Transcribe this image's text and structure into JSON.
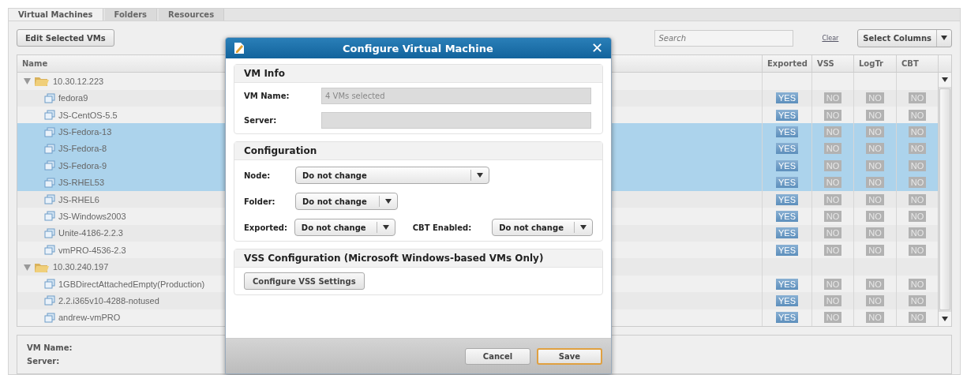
{
  "tabs": [
    {
      "label": "Virtual Machines",
      "selected": true
    },
    {
      "label": "Folders",
      "selected": false
    },
    {
      "label": "Resources",
      "selected": false
    }
  ],
  "toolbar": {
    "edit_button": "Edit Selected VMs",
    "search": {
      "placeholder": "Search"
    },
    "clear_link": "Clear",
    "columns_button": "Select Columns"
  },
  "table": {
    "columns": [
      "Name",
      "Exported",
      "VSS",
      "LogTr",
      "CBT"
    ],
    "groups": [
      {
        "name": "10.30.12.223",
        "expanded": true,
        "children": [
          {
            "name": "fedora9",
            "selected": false,
            "cells": [
              {
                "text": "YES",
                "on": true
              },
              {
                "text": "NO",
                "on": false
              },
              {
                "text": "NO",
                "on": false
              },
              {
                "text": "NO",
                "on": false
              }
            ]
          },
          {
            "name": "JS-CentOS-5.5",
            "selected": false,
            "cells": [
              {
                "text": "YES",
                "on": true
              },
              {
                "text": "NO",
                "on": false
              },
              {
                "text": "NO",
                "on": false
              },
              {
                "text": "NO",
                "on": false
              }
            ]
          },
          {
            "name": "JS-Fedora-13",
            "selected": true,
            "cells": [
              {
                "text": "YES",
                "on": true
              },
              {
                "text": "NO",
                "on": false
              },
              {
                "text": "NO",
                "on": false
              },
              {
                "text": "NO",
                "on": false
              }
            ]
          },
          {
            "name": "JS-Fedora-8",
            "selected": true,
            "cells": [
              {
                "text": "YES",
                "on": true
              },
              {
                "text": "NO",
                "on": false
              },
              {
                "text": "NO",
                "on": false
              },
              {
                "text": "NO",
                "on": false
              }
            ]
          },
          {
            "name": "JS-Fedora-9",
            "selected": true,
            "cells": [
              {
                "text": "YES",
                "on": true
              },
              {
                "text": "NO",
                "on": false
              },
              {
                "text": "NO",
                "on": false
              },
              {
                "text": "NO",
                "on": false
              }
            ]
          },
          {
            "name": "JS-RHEL53",
            "selected": true,
            "cells": [
              {
                "text": "YES",
                "on": true
              },
              {
                "text": "NO",
                "on": false
              },
              {
                "text": "NO",
                "on": false
              },
              {
                "text": "NO",
                "on": false
              }
            ]
          },
          {
            "name": "JS-RHEL6",
            "selected": false,
            "cells": [
              {
                "text": "YES",
                "on": true
              },
              {
                "text": "NO",
                "on": false
              },
              {
                "text": "NO",
                "on": false
              },
              {
                "text": "NO",
                "on": false
              }
            ]
          },
          {
            "name": "JS-Windows2003",
            "selected": false,
            "cells": [
              {
                "text": "YES",
                "on": true
              },
              {
                "text": "NO",
                "on": false
              },
              {
                "text": "NO",
                "on": false
              },
              {
                "text": "NO",
                "on": false
              }
            ]
          },
          {
            "name": "Unite-4186-2.2.3",
            "selected": false,
            "cells": [
              {
                "text": "YES",
                "on": true
              },
              {
                "text": "NO",
                "on": false
              },
              {
                "text": "NO",
                "on": false
              },
              {
                "text": "NO",
                "on": false
              }
            ]
          },
          {
            "name": "vmPRO-4536-2.3",
            "selected": false,
            "cells": [
              {
                "text": "YES",
                "on": true
              },
              {
                "text": "NO",
                "on": false
              },
              {
                "text": "NO",
                "on": false
              },
              {
                "text": "NO",
                "on": false
              }
            ]
          }
        ]
      },
      {
        "name": "10.30.240.197",
        "expanded": true,
        "children": [
          {
            "name": "1GBDirectAttachedEmpty(Production)",
            "selected": false,
            "cells": [
              {
                "text": "YES",
                "on": true
              },
              {
                "text": "NO",
                "on": false
              },
              {
                "text": "NO",
                "on": false
              },
              {
                "text": "NO",
                "on": false
              }
            ]
          },
          {
            "name": "2.2.i365v10-4288-notused",
            "selected": false,
            "cells": [
              {
                "text": "YES",
                "on": true
              },
              {
                "text": "NO",
                "on": false
              },
              {
                "text": "NO",
                "on": false
              },
              {
                "text": "NO",
                "on": false
              }
            ]
          },
          {
            "name": "andrew-vmPRO",
            "selected": false,
            "cells": [
              {
                "text": "YES",
                "on": true
              },
              {
                "text": "NO",
                "on": false
              },
              {
                "text": "NO",
                "on": false
              },
              {
                "text": "NO",
                "on": false
              }
            ]
          }
        ]
      }
    ]
  },
  "details": {
    "labels": [
      "VM Name:",
      "Server:"
    ]
  },
  "dialog": {
    "title": "Configure Virtual Machine",
    "close": "✕",
    "vm_info": {
      "title": "VM Info",
      "fields": [
        {
          "label": "VM Name:",
          "value": "4 VMs selected"
        },
        {
          "label": "Server:"
        }
      ]
    },
    "configuration": {
      "title": "Configuration",
      "rows": [
        [
          {
            "label": "Node:",
            "value": "Do not change",
            "wide": true
          }
        ],
        [
          {
            "label": "Folder:",
            "value": "Do not change",
            "wide": false
          }
        ],
        [
          {
            "label": "Exported:",
            "value": "Do not change",
            "wide": false
          },
          {
            "label": "CBT Enabled:",
            "value": "Do not change",
            "wide": false
          }
        ]
      ]
    },
    "vss": {
      "title": "VSS Configuration (Microsoft Windows-based VMs Only)",
      "button": "Configure VSS Settings"
    },
    "buttons": [
      {
        "label": "Cancel",
        "default": false
      },
      {
        "label": "Save",
        "default": true
      }
    ]
  }
}
